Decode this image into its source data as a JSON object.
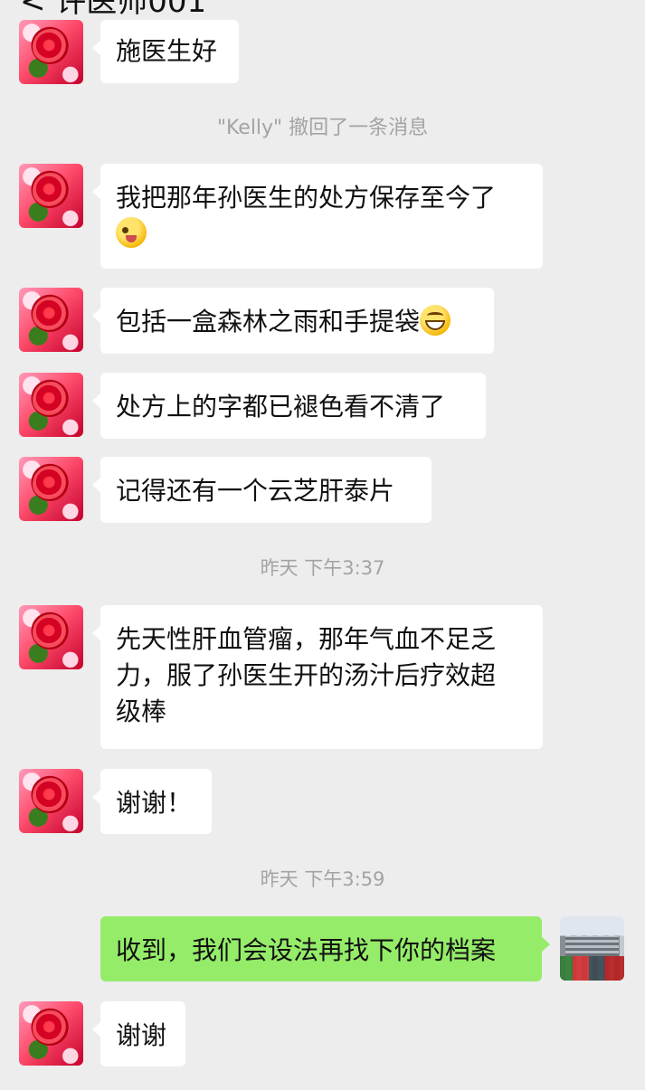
{
  "header": {
    "title": "< 许医师001"
  },
  "messages": {
    "m1": "施医生好",
    "recall": "\"Kelly\" 撤回了一条消息",
    "m2_line1": "我把那年孙医生的处方保存至今了",
    "m3": "包括一盒森林之雨和手提袋",
    "m4": "处方上的字都已褪色看不清了",
    "m5": "记得还有一个云芝肝泰片",
    "time1": "昨天 下午3:37",
    "m6_line1": "先天性肝血管瘤，那年气血不足乏",
    "m6_line2": "力，服了孙医生开的汤汁后疗效超",
    "m6_line3": "级棒",
    "m7": "谢谢！",
    "time2": "昨天 下午3:59",
    "m8": "收到，我们会设法再找下你的档案",
    "m9": "谢谢"
  },
  "emoji": {
    "wink": "wink-tongue-emoji",
    "grin": "grinning-emoji"
  },
  "colors": {
    "background": "#ededed",
    "bubble_in": "#ffffff",
    "bubble_out": "#95ec69",
    "system_text": "#a3a3a3"
  }
}
